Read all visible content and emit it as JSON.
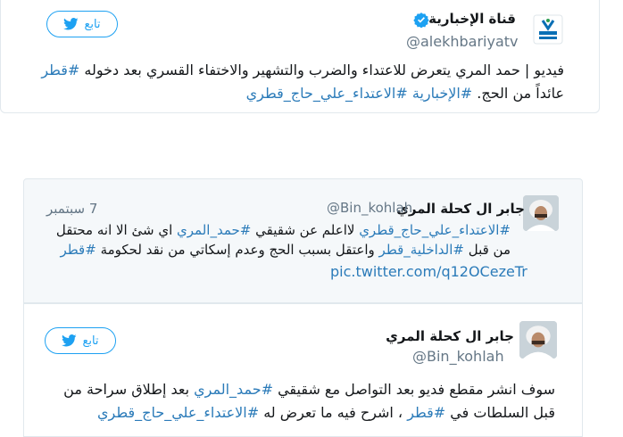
{
  "tweet1": {
    "account_name": "قناة الإخبارية",
    "handle": "@alekhbariyatv",
    "follow_label": "تابع",
    "text_parts": [
      "فيديو | حمد المري يتعرض للاعتداء والضرب والتشهير والاختفاء القسري بعد دخوله ",
      "#قطر",
      " عائداً من الحج. ",
      "#الإخبارية",
      " ",
      "#الاعتداء_علي_حاج_قطري"
    ]
  },
  "quoted": {
    "account_name": "جابر ال كحلة المري",
    "handle": "@Bin_kohlah",
    "date": "7 سبتمبر",
    "text_parts": [
      "#الاعتداء_علي_حاج_قطري",
      " لااعلم عن شقيقي ",
      "#حمد_المري",
      " اي شئ الا انه محتقل من قبل ",
      "#الداخلية_قطر",
      " واعتقل بسبب الحج وعدم إسكاتي من نقد لحكومة ",
      "#قطر"
    ],
    "link": "pic.twitter.com/q12OCezeTr"
  },
  "tweet2": {
    "account_name": "جابر ال كحلة المري",
    "handle": "@Bin_kohlah",
    "follow_label": "تابع",
    "text_parts": [
      "سوف انشر مقطع فديو بعد التواصل مع شقيقي ",
      "#حمد_المري",
      " بعد إطلاق سراحة من قبل السلطات في ",
      "#قطر",
      " ، اشرح فيه ما تعرض له ",
      "#الاعتداء_علي_حاج_قطري"
    ]
  },
  "icons": {
    "twitter": "twitter-bird-icon",
    "verified": "verified-badge-icon"
  },
  "colors": {
    "accent": "#1da1f2",
    "link": "#2b7bb9",
    "muted": "#657786"
  }
}
